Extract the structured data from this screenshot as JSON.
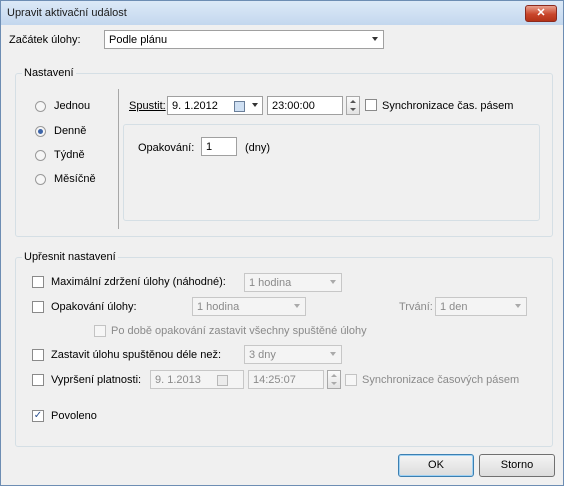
{
  "window": {
    "title": "Upravit aktivační událost",
    "close_glyph": "✕"
  },
  "trigger": {
    "label": "Začátek úlohy:",
    "value": "Podle plánu"
  },
  "settings": {
    "group_label": "Nastavení",
    "frequency": [
      {
        "label": "Jednou",
        "selected": false
      },
      {
        "label": "Denně",
        "selected": true
      },
      {
        "label": "Týdně",
        "selected": false
      },
      {
        "label": "Měsíčně",
        "selected": false
      }
    ],
    "start_label": "Spustit:",
    "start_date": "9. 1.2012",
    "start_time": "23:00:00",
    "sync_label": "Synchronizace čas. pásem",
    "repeat_label": "Opakování:",
    "repeat_value": "1",
    "repeat_unit": "(dny)"
  },
  "advanced": {
    "group_label": "Upřesnit nastavení",
    "max_delay": {
      "label": "Maximální zdržení úlohy (náhodné):",
      "value": "1 hodina",
      "checked": false
    },
    "repeat_task": {
      "label": "Opakování úlohy:",
      "value": "1 hodina",
      "checked": false,
      "duration_label": "Trvání:",
      "duration_value": "1 den"
    },
    "stop_at_end": {
      "label": "Po době opakování zastavit všechny spuštěné úlohy",
      "checked": false
    },
    "stop_after": {
      "label": "Zastavit úlohu spuštěnou déle než:",
      "value": "3 dny",
      "checked": false
    },
    "expire": {
      "label": "Vypršení platnosti:",
      "date": "9. 1.2013",
      "time": "14:25:07",
      "checked": false,
      "sync_label": "Synchronizace časových pásem"
    },
    "enabled": {
      "label": "Povoleno",
      "checked": true
    }
  },
  "buttons": {
    "ok": "OK",
    "cancel": "Storno"
  },
  "colors": {
    "accent": "#3c64a8",
    "border": "#6d8db3",
    "close": "#c9462b"
  }
}
